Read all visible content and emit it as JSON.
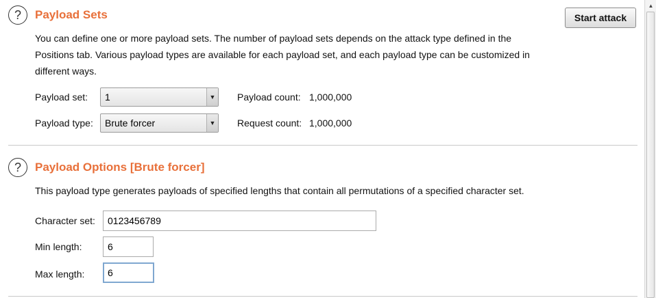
{
  "payload_sets": {
    "title": "Payload Sets",
    "help_icon": "?",
    "start_attack_label": "Start attack",
    "description_lines": [
      "You can define one or more payload sets. The number of payload sets depends on the attack type defined in the",
      "Positions tab. Various payload types are available for each payload set, and each payload type can be customized in",
      "different ways."
    ],
    "payload_set_label": "Payload set:",
    "payload_set_value": "1",
    "payload_type_label": "Payload type:",
    "payload_type_value": "Brute forcer",
    "payload_count_label": "Payload count:",
    "payload_count_value": "1,000,000",
    "request_count_label": "Request count:",
    "request_count_value": "1,000,000"
  },
  "payload_options": {
    "title": "Payload Options [Brute forcer]",
    "help_icon": "?",
    "description": "This payload type generates payloads of specified lengths that contain all permutations of a specified character set.",
    "character_set_label": "Character set:",
    "character_set_value": "0123456789",
    "min_length_label": "Min length:",
    "min_length_value": "6",
    "max_length_label": "Max length:",
    "max_length_value": "6"
  },
  "icons": {
    "dropdown_arrow": "▼",
    "scroll_up": "▲"
  }
}
